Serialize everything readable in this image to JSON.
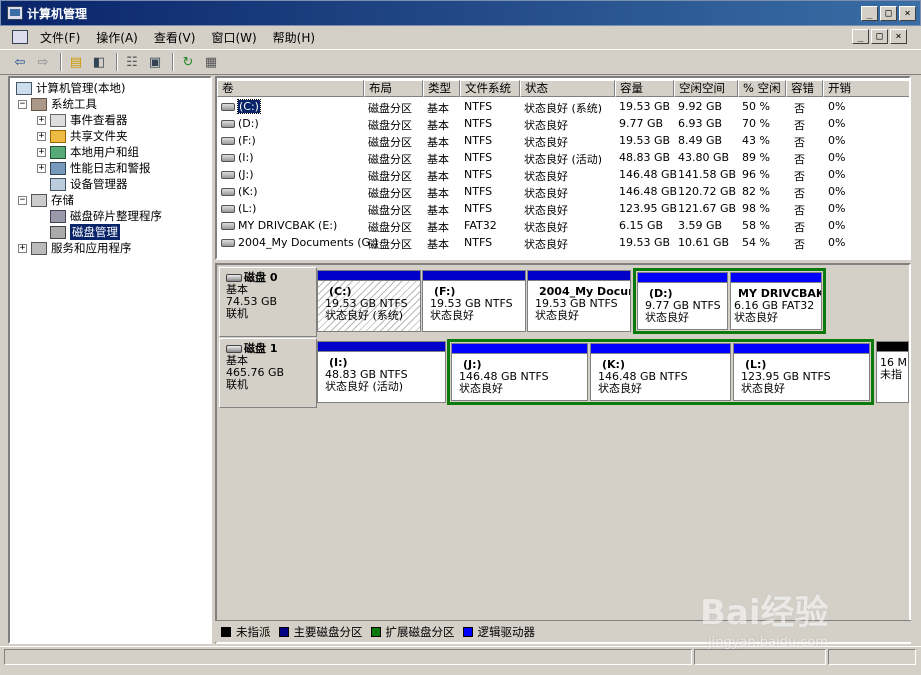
{
  "window": {
    "title": "计算机管理",
    "btn_min": "_",
    "btn_max": "□",
    "btn_close": "×"
  },
  "menu": [
    "文件(F)",
    "操作(A)",
    "查看(V)",
    "窗口(W)",
    "帮助(H)"
  ],
  "tree": [
    {
      "label": "计算机管理(本地)",
      "level": 0,
      "expander": ""
    },
    {
      "label": "系统工具",
      "level": 1,
      "expander": "−"
    },
    {
      "label": "事件查看器",
      "level": 2,
      "expander": "+"
    },
    {
      "label": "共享文件夹",
      "level": 2,
      "expander": "+"
    },
    {
      "label": "本地用户和组",
      "level": 2,
      "expander": "+"
    },
    {
      "label": "性能日志和警报",
      "level": 2,
      "expander": "+"
    },
    {
      "label": "设备管理器",
      "level": 2,
      "expander": ""
    },
    {
      "label": "存储",
      "level": 1,
      "expander": "−"
    },
    {
      "label": "磁盘碎片整理程序",
      "level": 2,
      "expander": ""
    },
    {
      "label": "磁盘管理",
      "level": 2,
      "expander": "",
      "selected": true
    },
    {
      "label": "服务和应用程序",
      "level": 1,
      "expander": "+"
    }
  ],
  "volume_columns": [
    "卷",
    "布局",
    "类型",
    "文件系统",
    "状态",
    "容量",
    "空闲空间",
    "% 空闲",
    "容错",
    "开销"
  ],
  "volumes": [
    [
      "(C:)",
      "磁盘分区",
      "基本",
      "NTFS",
      "状态良好 (系统)",
      "19.53 GB",
      "9.92 GB",
      "50 %",
      "否",
      "0%"
    ],
    [
      "(D:)",
      "磁盘分区",
      "基本",
      "NTFS",
      "状态良好",
      "9.77 GB",
      "6.93 GB",
      "70 %",
      "否",
      "0%"
    ],
    [
      "(F:)",
      "磁盘分区",
      "基本",
      "NTFS",
      "状态良好",
      "19.53 GB",
      "8.49 GB",
      "43 %",
      "否",
      "0%"
    ],
    [
      "(I:)",
      "磁盘分区",
      "基本",
      "NTFS",
      "状态良好 (活动)",
      "48.83 GB",
      "43.80 GB",
      "89 %",
      "否",
      "0%"
    ],
    [
      "(J:)",
      "磁盘分区",
      "基本",
      "NTFS",
      "状态良好",
      "146.48 GB",
      "141.58 GB",
      "96 %",
      "否",
      "0%"
    ],
    [
      "(K:)",
      "磁盘分区",
      "基本",
      "NTFS",
      "状态良好",
      "146.48 GB",
      "120.72 GB",
      "82 %",
      "否",
      "0%"
    ],
    [
      "(L:)",
      "磁盘分区",
      "基本",
      "NTFS",
      "状态良好",
      "123.95 GB",
      "121.67 GB",
      "98 %",
      "否",
      "0%"
    ],
    [
      "MY DRIVCBAK (E:)",
      "磁盘分区",
      "基本",
      "FAT32",
      "状态良好",
      "6.15 GB",
      "3.59 GB",
      "58 %",
      "否",
      "0%"
    ],
    [
      "2004_My Documents (G:)",
      "磁盘分区",
      "基本",
      "NTFS",
      "状态良好",
      "19.53 GB",
      "10.61 GB",
      "54 %",
      "否",
      "0%"
    ]
  ],
  "disks": [
    {
      "name": "磁盘 0",
      "type": "基本",
      "size": "74.53 GB",
      "status": "联机",
      "partitions": [
        {
          "name": "(C:)",
          "size": "19.53 GB NTFS",
          "status": "状态良好 (系统)"
        },
        {
          "name": "(F:)",
          "size": "19.53 GB NTFS",
          "status": "状态良好"
        },
        {
          "name": "2004_My Docun",
          "size": "19.53 GB NTFS",
          "status": "状态良好"
        },
        {
          "name": "(D:)",
          "size": "9.77 GB NTFS",
          "status": "状态良好"
        },
        {
          "name": "MY DRIVCBAK",
          "size": "6.16 GB FAT32",
          "status": "状态良好"
        }
      ]
    },
    {
      "name": "磁盘 1",
      "type": "基本",
      "size": "465.76 GB",
      "status": "联机",
      "partitions": [
        {
          "name": "(I:)",
          "size": "48.83 GB NTFS",
          "status": "状态良好 (活动)"
        },
        {
          "name": "(J:)",
          "size": "146.48 GB NTFS",
          "status": "状态良好"
        },
        {
          "name": "(K:)",
          "size": "146.48 GB NTFS",
          "status": "状态良好"
        },
        {
          "name": "(L:)",
          "size": "123.95 GB NTFS",
          "status": "状态良好"
        },
        {
          "name": "",
          "size": "16 M",
          "status": "未指"
        }
      ]
    }
  ],
  "legend": [
    {
      "label": "未指派",
      "color": "#000000"
    },
    {
      "label": "主要磁盘分区",
      "color": "#000080"
    },
    {
      "label": "扩展磁盘分区",
      "color": "#0a7a0a"
    },
    {
      "label": "逻辑驱动器",
      "color": "#0000ff"
    }
  ],
  "watermark": {
    "text": "Bai经验",
    "sub": "jingyan.baidu.com"
  }
}
